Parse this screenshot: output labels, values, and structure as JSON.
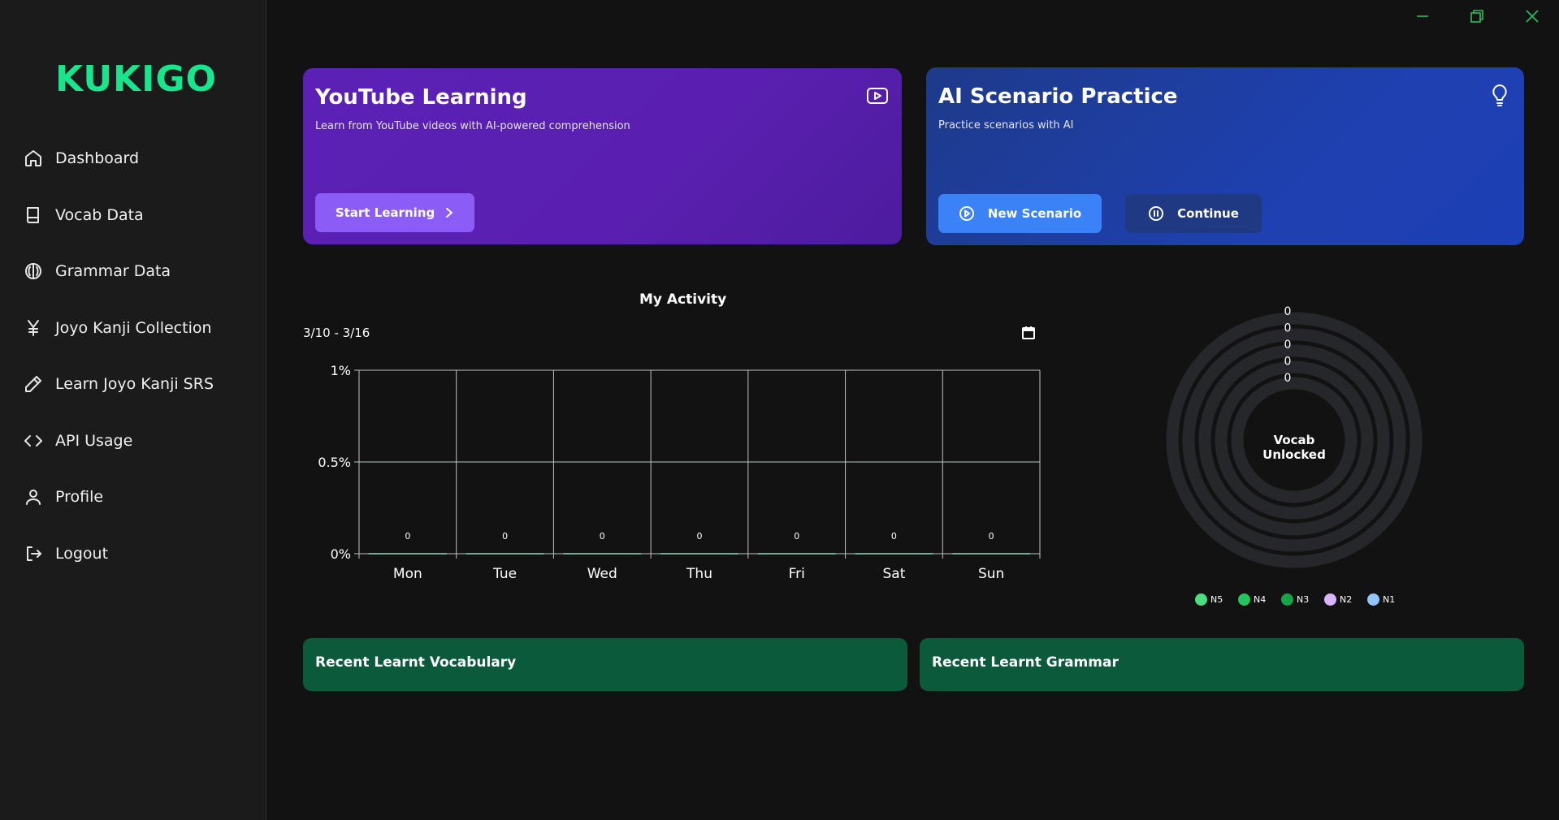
{
  "app": {
    "logo": "KUKIGO"
  },
  "sidebar": {
    "items": [
      {
        "label": "Dashboard",
        "icon": "home-icon"
      },
      {
        "label": "Vocab Data",
        "icon": "book-icon"
      },
      {
        "label": "Grammar Data",
        "icon": "brain-icon"
      },
      {
        "label": "Joyo Kanji Collection",
        "icon": "yen-icon"
      },
      {
        "label": "Learn Joyo Kanji SRS",
        "icon": "pencil-icon"
      },
      {
        "label": "API Usage",
        "icon": "code-icon"
      },
      {
        "label": "Profile",
        "icon": "user-icon"
      },
      {
        "label": "Logout",
        "icon": "logout-icon"
      }
    ]
  },
  "youtube_card": {
    "title": "YouTube Learning",
    "subtitle": "Learn from YouTube videos with AI-powered comprehension",
    "button": "Start Learning",
    "icon": "youtube-icon",
    "color": "#5b21b6"
  },
  "ai_card": {
    "title": "AI Scenario Practice",
    "subtitle": "Practice scenarios with AI",
    "new_button": "New Scenario",
    "continue_button": "Continue",
    "icon": "lightbulb-icon",
    "color": "#1e40af"
  },
  "activity": {
    "title": "My Activity",
    "date_range": "3/10 - 3/16"
  },
  "chart_data": {
    "type": "bar",
    "title": "My Activity",
    "categories": [
      "Mon",
      "Tue",
      "Wed",
      "Thu",
      "Fri",
      "Sat",
      "Sun"
    ],
    "values": [
      0,
      0,
      0,
      0,
      0,
      0,
      0
    ],
    "data_labels": [
      "0",
      "0",
      "0",
      "0",
      "0",
      "0",
      "0"
    ],
    "y_ticks": [
      "0%",
      "0.5%",
      "1%"
    ],
    "ylim": [
      0,
      1
    ],
    "grid": true
  },
  "vocab_donut": {
    "center_label": "Vocab Unlocked",
    "ring_values": [
      "0",
      "0",
      "0",
      "0",
      "0"
    ],
    "legend": [
      {
        "label": "N5",
        "color": "#4ade80"
      },
      {
        "label": "N4",
        "color": "#22c55e"
      },
      {
        "label": "N3",
        "color": "#16a34a"
      },
      {
        "label": "N2",
        "color": "#d8b4fe"
      },
      {
        "label": "N1",
        "color": "#93c5fd"
      }
    ]
  },
  "recent": {
    "vocab_title": "Recent Learnt Vocabulary",
    "grammar_title": "Recent Learnt Grammar"
  },
  "colors": {
    "accent": "#19e68c",
    "recent_bg": "#0b5a3c"
  }
}
